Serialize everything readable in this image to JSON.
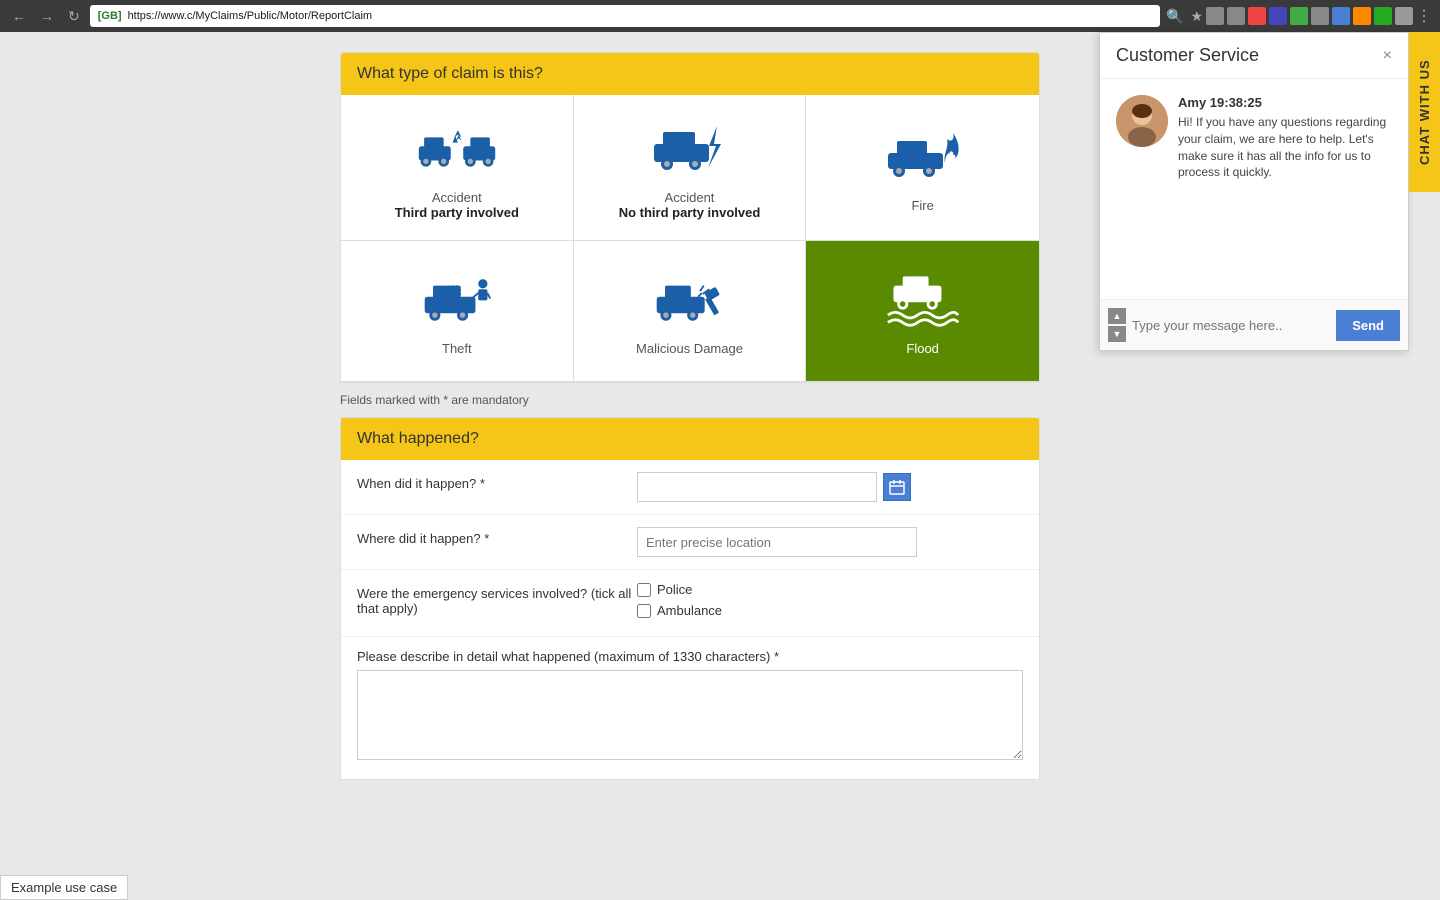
{
  "browser": {
    "address_label": "[GB]",
    "address_url": "https://www.c",
    "address_path": "/MyClaims/Public/Motor/ReportClaim"
  },
  "page": {
    "claim_type_header": "What type of claim is this?",
    "mandatory_note": "Fields marked with * are mandatory",
    "what_happened_header": "What happened?",
    "when_label": "When did it happen? *",
    "where_label": "Where did it happen? *",
    "where_placeholder": "Enter precise location",
    "emergency_label": "Were the emergency services involved? (tick all that apply)",
    "emergency_options": [
      "Police",
      "Ambulance"
    ],
    "describe_label": "Please describe in detail what happened (maximum of 1330 characters) *"
  },
  "claim_types": [
    {
      "id": "accident-third-party",
      "label": "Accident",
      "sub": "Third party involved",
      "selected": false,
      "icon": "two-cars-crash"
    },
    {
      "id": "accident-no-third-party",
      "label": "Accident",
      "sub": "No third party involved",
      "selected": false,
      "icon": "car-lightning"
    },
    {
      "id": "fire",
      "label": "Fire",
      "sub": "",
      "selected": false,
      "icon": "car-fire"
    },
    {
      "id": "theft",
      "label": "Theft",
      "sub": "",
      "selected": false,
      "icon": "car-break-in"
    },
    {
      "id": "malicious-damage",
      "label": "Malicious Damage",
      "sub": "",
      "selected": false,
      "icon": "car-hammer"
    },
    {
      "id": "flood",
      "label": "Flood",
      "sub": "",
      "selected": true,
      "icon": "car-flood"
    }
  ],
  "chat": {
    "tab_label": "CHAT WITH US",
    "panel_title": "Customer Service",
    "close_label": "×",
    "agent_name": "Amy 19:38:25",
    "agent_message": "Hi! If you have any questions regarding your claim, we are here to help. Let's make sure it has all the info for us to process it quickly.",
    "input_placeholder": "Type your message here..",
    "send_label": "Send"
  },
  "example_label": "Example use case"
}
